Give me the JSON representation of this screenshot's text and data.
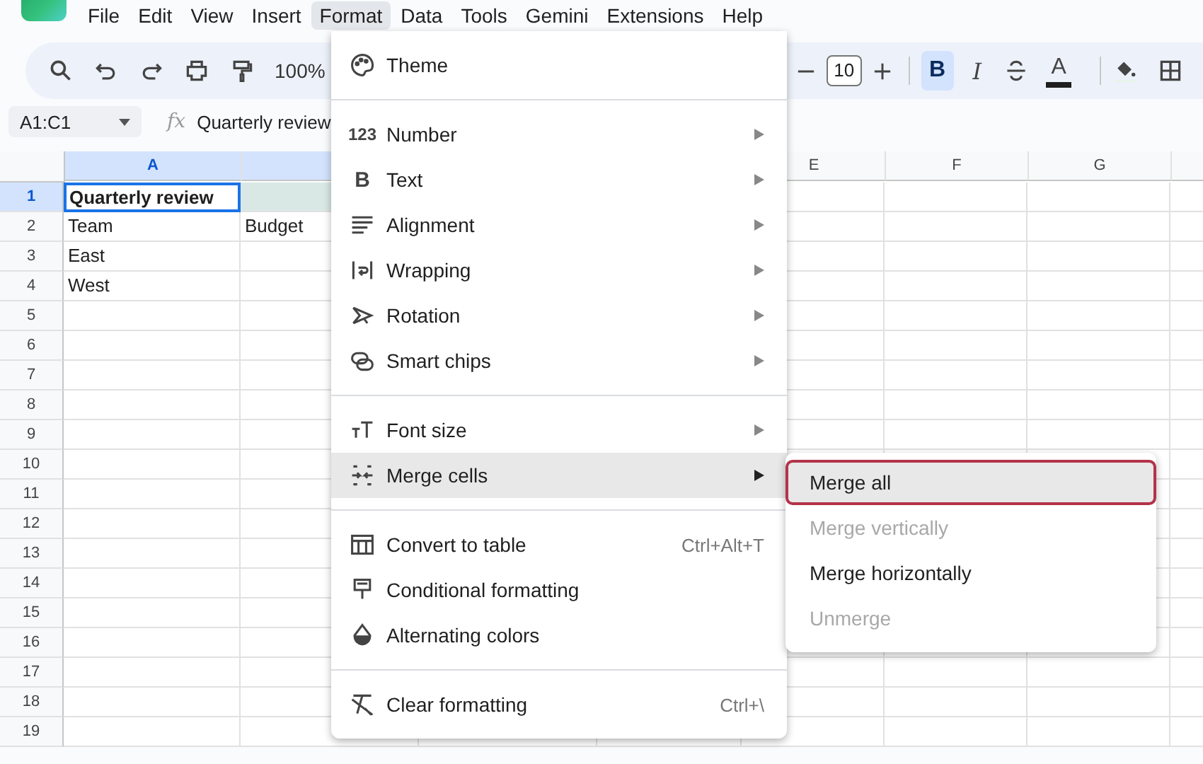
{
  "menubar": [
    {
      "label": "File",
      "selected": false
    },
    {
      "label": "Edit",
      "selected": false
    },
    {
      "label": "View",
      "selected": false
    },
    {
      "label": "Insert",
      "selected": false
    },
    {
      "label": "Format",
      "selected": true
    },
    {
      "label": "Data",
      "selected": false
    },
    {
      "label": "Tools",
      "selected": false
    },
    {
      "label": "Gemini",
      "selected": false
    },
    {
      "label": "Extensions",
      "selected": false
    },
    {
      "label": "Help",
      "selected": false
    }
  ],
  "toolbar": {
    "zoom": "100%",
    "font_size": "10",
    "format_buttons": [
      {
        "kind": "bold",
        "glyph": "B",
        "selected": true
      },
      {
        "kind": "italic",
        "glyph": "I",
        "selected": false
      },
      {
        "kind": "strikethrough",
        "selected": false
      },
      {
        "kind": "text_color",
        "glyph": "A",
        "selected": false
      }
    ]
  },
  "formula_bar": {
    "name_box": "A1:C1",
    "fx_label": "fx",
    "formula": "Quarterly review"
  },
  "sheet": {
    "columns": [
      {
        "label": "A",
        "selected": true
      },
      {
        "selected": true
      },
      {},
      {},
      {
        "label": "E",
        "selected": false
      },
      {
        "label": "F",
        "selected": false
      },
      {
        "label": "G",
        "selected": false
      },
      {
        "selected": false
      }
    ],
    "rows": [
      {
        "number": "1",
        "selected": true,
        "cells": [
          {
            "text": "Quarterly review",
            "bold": true,
            "active": true
          },
          {
            "in_range": true
          }
        ]
      },
      {
        "number": "2",
        "selected": false,
        "cells": [
          {
            "text": "Team"
          },
          {
            "text": "Budget"
          }
        ]
      },
      {
        "number": "3",
        "selected": false,
        "cells": [
          {
            "text": "East"
          }
        ]
      },
      {
        "number": "4",
        "selected": false,
        "cells": [
          {
            "text": "West"
          }
        ]
      },
      {
        "number": "5",
        "selected": false
      },
      {
        "number": "6",
        "selected": false
      },
      {
        "number": "7",
        "selected": false
      },
      {
        "number": "8",
        "selected": false
      },
      {
        "number": "9",
        "selected": false
      },
      {
        "number": "10",
        "selected": false
      },
      {
        "number": "11",
        "selected": false
      },
      {
        "number": "12",
        "selected": false
      },
      {
        "number": "13",
        "selected": false
      },
      {
        "number": "14",
        "selected": false
      },
      {
        "number": "15",
        "selected": false
      },
      {
        "number": "16",
        "selected": false
      },
      {
        "number": "17",
        "selected": false
      },
      {
        "number": "18",
        "selected": false
      },
      {
        "number": "19",
        "selected": false
      }
    ]
  },
  "format_menu": {
    "sections": [
      [
        {
          "label": "Theme",
          "highlighted": false,
          "submenu": false
        }
      ],
      [
        {
          "label": "Number",
          "glyph": "123",
          "highlighted": false,
          "submenu": true
        },
        {
          "label": "Text",
          "glyph": "B",
          "highlighted": false,
          "submenu": true
        },
        {
          "label": "Alignment",
          "highlighted": false,
          "submenu": true
        },
        {
          "label": "Wrapping",
          "highlighted": false,
          "submenu": true
        },
        {
          "label": "Rotation",
          "highlighted": false,
          "submenu": true
        },
        {
          "label": "Smart chips",
          "highlighted": false,
          "submenu": true
        }
      ],
      [
        {
          "label": "Font size",
          "highlighted": false,
          "submenu": true
        },
        {
          "label": "Merge cells",
          "highlighted": true,
          "submenu": true
        }
      ],
      [
        {
          "label": "Convert to table",
          "shortcut": "Ctrl+Alt+T",
          "highlighted": false,
          "submenu": false
        },
        {
          "label": "Conditional formatting",
          "highlighted": false,
          "submenu": false
        },
        {
          "label": "Alternating colors",
          "highlighted": false,
          "submenu": false
        }
      ],
      [
        {
          "label": "Clear formatting",
          "shortcut": "Ctrl+\\",
          "highlighted": false,
          "submenu": false
        }
      ]
    ]
  },
  "merge_submenu": [
    {
      "label": "Merge all",
      "selected": true,
      "disabled": false
    },
    {
      "label": "Merge vertically",
      "selected": false,
      "disabled": true
    },
    {
      "label": "Merge horizontally",
      "selected": false,
      "disabled": false
    },
    {
      "label": "Unmerge",
      "selected": false,
      "disabled": true
    }
  ]
}
